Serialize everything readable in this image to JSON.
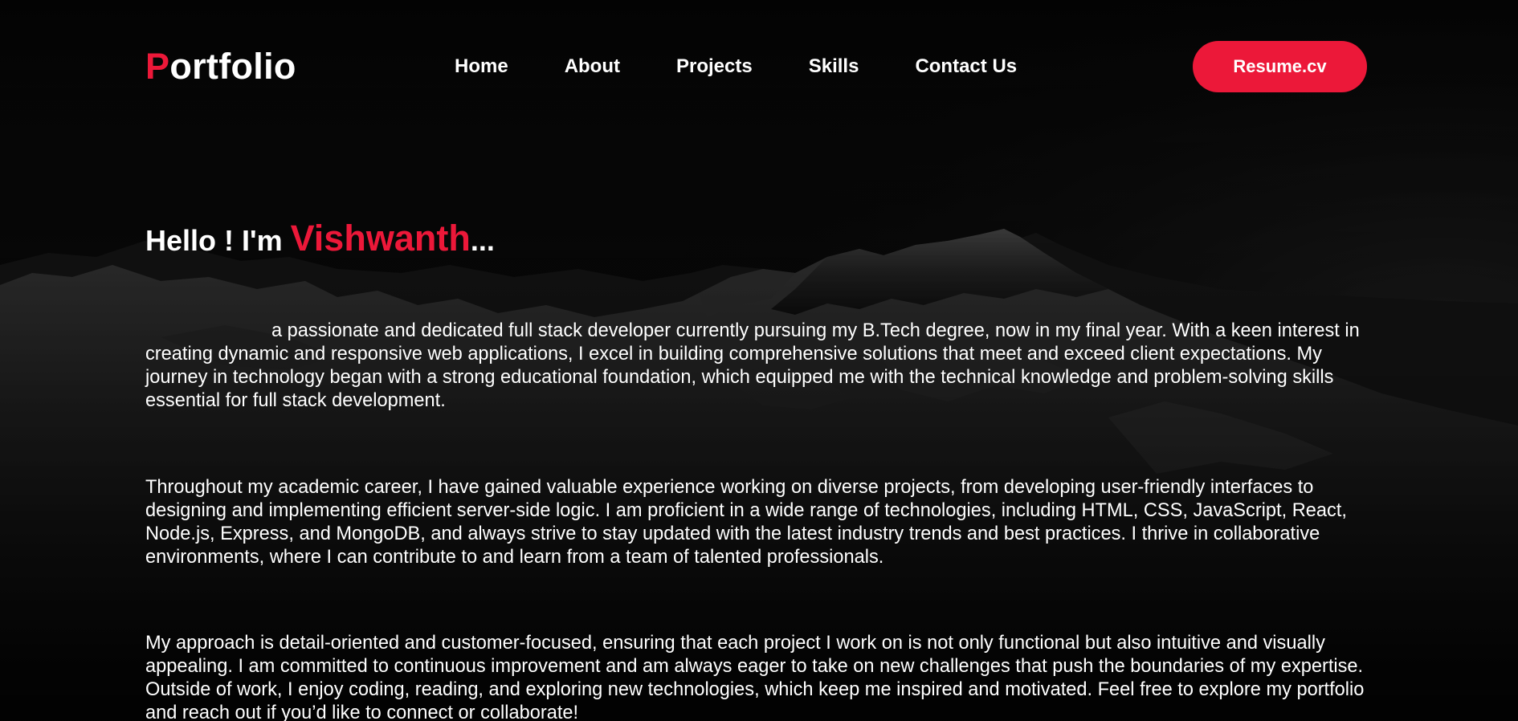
{
  "header": {
    "logo_initial": "P",
    "logo_rest": "ortfolio",
    "nav": [
      "Home",
      "About",
      "Projects",
      "Skills",
      "Contact Us"
    ],
    "resume_label": "Resume.cv"
  },
  "hero": {
    "greeting_prefix": "Hello ! I'm ",
    "name": "Vishwanth",
    "greeting_suffix": "...",
    "paragraphs": [
      "a passionate and dedicated full stack developer currently pursuing my B.Tech degree, now in my final year. With a keen interest in creating dynamic and responsive web applications, I excel in building comprehensive solutions that meet and exceed client expectations. My journey in technology began with a strong educational foundation, which equipped me with the technical knowledge and problem-solving skills essential for full stack development.",
      "Throughout my academic career, I have gained valuable experience working on diverse projects, from developing user-friendly interfaces to designing and implementing efficient server-side logic. I am proficient in a wide range of technologies, including HTML, CSS, JavaScript, React, Node.js, Express, and MongoDB, and always strive to stay updated with the latest industry trends and best practices. I thrive in collaborative environments, where I can contribute to and learn from a team of talented professionals.",
      "My approach is detail-oriented and customer-focused, ensuring that each project I work on is not only functional but also intuitive and visually appealing. I am committed to continuous improvement and am always eager to take on new challenges that push the boundaries of my expertise. Outside of work, I enjoy coding, reading, and exploring new technologies, which keep me inspired and motivated. Feel free to explore my portfolio and reach out if you’d like to connect or collaborate!"
    ]
  },
  "colors": {
    "accent": "#ec1839",
    "background": "#000000",
    "text": "#ffffff"
  },
  "icons": {
    "background": "mountain-landscape-image"
  }
}
